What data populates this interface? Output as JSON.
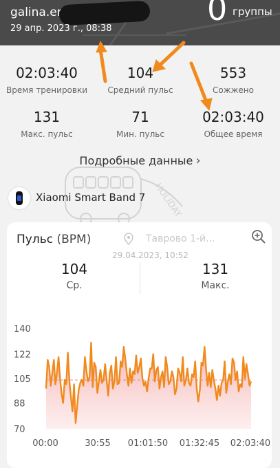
{
  "header": {
    "user_visible": "galina.er",
    "date": "29 апр. 2023 г., 08:38",
    "group_count": "0",
    "group_label": "группы"
  },
  "stats": [
    {
      "value": "02:03:40",
      "label": "Время тренировки"
    },
    {
      "value": "104",
      "label": "Средний пульс"
    },
    {
      "value": "553",
      "label": "Сожжено"
    },
    {
      "value": "131",
      "label": "Макс. пульс"
    },
    {
      "value": "71",
      "label": "Мин. пульс"
    },
    {
      "value": "02:03:40",
      "label": "Общее время"
    }
  ],
  "details_link": "Подробные данные",
  "device": {
    "name": "Xiaomi Smart Band 7"
  },
  "watermark_text": "HOLIDAY",
  "card": {
    "title": "Пульс",
    "unit": "(BPM)",
    "location": "Таврово 1-й...",
    "timestamp": "29.04.2023, 10:52",
    "summary": [
      {
        "value": "104",
        "label": "Ср."
      },
      {
        "value": "131",
        "label": "Макс."
      }
    ]
  },
  "colors": {
    "accent": "#f08a1c",
    "fill": "#f7c4c4",
    "header_bg": "#4a4a4a"
  },
  "chart_data": {
    "type": "line",
    "title": "Пульс (BPM)",
    "ylim": [
      70,
      140
    ],
    "yticks": [
      70,
      88,
      105,
      122,
      140
    ],
    "xticks": [
      "00:00",
      "30:55",
      "01:01:50",
      "01:32:45",
      "02:03:40"
    ],
    "average_line": 104,
    "series": [
      {
        "values": [
          98,
          118,
          113,
          100,
          109,
          118,
          101,
          109,
          120,
          105,
          94,
          88,
          104,
          101,
          123,
          103,
          92,
          82,
          101,
          74,
          86,
          97,
          102,
          104,
          100,
          120,
          110,
          103,
          106,
          130,
          99,
          116,
          113,
          95,
          103,
          111,
          102,
          104,
          115,
          104,
          93,
          109,
          114,
          98,
          103,
          120,
          101,
          102,
          117,
          113,
          127,
          119,
          108,
          100,
          112,
          102,
          110,
          108,
          121,
          109,
          113,
          119,
          105,
          100,
          103,
          96,
          105,
          112,
          112,
          122,
          103,
          111,
          113,
          98,
          106,
          110,
          99,
          120,
          113,
          101,
          103,
          110,
          106,
          94,
          98,
          112,
          109,
          103,
          120,
          100,
          104,
          112,
          102,
          100,
          108,
          106,
          117,
          98,
          89,
          97,
          116,
          114,
          127,
          112,
          100,
          109,
          99,
          111,
          104,
          98,
          90,
          100,
          93,
          102,
          104,
          117,
          95,
          103,
          108,
          101,
          119,
          116,
          104,
          110,
          96,
          101,
          99,
          120,
          105,
          115,
          108,
          100,
          103
        ]
      }
    ]
  }
}
